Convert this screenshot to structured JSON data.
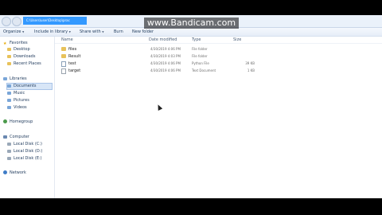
{
  "watermark": {
    "text": "www.Bandicam.com"
  },
  "address_bar": {
    "value": "C:\\Users\\user\\Desktop\\prac"
  },
  "toolbar": {
    "organize": "Organize",
    "include": "Include in library",
    "share": "Share with",
    "burn": "Burn",
    "new_folder": "New folder",
    "chevron": "▼"
  },
  "nav": {
    "favorites": "Favorites",
    "desktop": "Desktop",
    "downloads": "Downloads",
    "recent": "Recent Places",
    "libraries": "Libraries",
    "documents": "Documents",
    "music": "Music",
    "pictures": "Pictures",
    "videos": "Videos",
    "homegroup": "Homegroup",
    "computer": "Computer",
    "disk_c": "Local Disk (C:)",
    "disk_d": "Local Disk (D:)",
    "disk_e": "Local Disk (E:)",
    "network": "Network"
  },
  "columns": {
    "name": "Name",
    "date": "Date modified",
    "type": "Type",
    "size": "Size"
  },
  "files": [
    {
      "name": "files",
      "date": "4/30/2019 4:06 PM",
      "type": "File folder",
      "size": "",
      "icon": "folder-icon"
    },
    {
      "name": "Result",
      "date": "4/30/2019 4:03 PM",
      "type": "File folder",
      "size": "",
      "icon": "folder-icon"
    },
    {
      "name": "test",
      "date": "4/30/2019 4:06 PM",
      "type": "Python File",
      "size": "39 KB",
      "icon": "python-file-icon"
    },
    {
      "name": "target",
      "date": "4/30/2019 4:06 PM",
      "type": "Text Document",
      "size": "1 KB",
      "icon": "text-file-icon"
    }
  ]
}
